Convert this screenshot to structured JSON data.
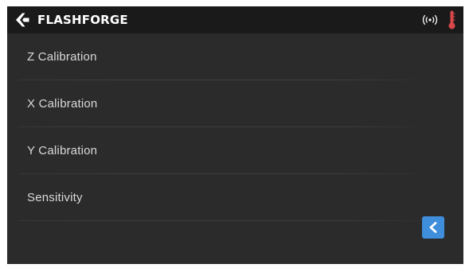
{
  "header": {
    "brand": "FLASHFORGE",
    "icons": {
      "logo": "flashforge-logo-icon",
      "connection": "wireless-signal-icon",
      "temperature": "thermometer-icon"
    }
  },
  "menu": {
    "items": [
      {
        "label": "Z Calibration"
      },
      {
        "label": "X Calibration"
      },
      {
        "label": "Y Calibration"
      },
      {
        "label": "Sensitivity"
      }
    ]
  },
  "navigation": {
    "back_icon": "chevron-left-icon"
  },
  "colors": {
    "background": "#2b2b2c",
    "header_background": "#1a1a1b",
    "text": "#d9d9d9",
    "accent": "#3e8edb",
    "thermometer": "#d8474a"
  }
}
